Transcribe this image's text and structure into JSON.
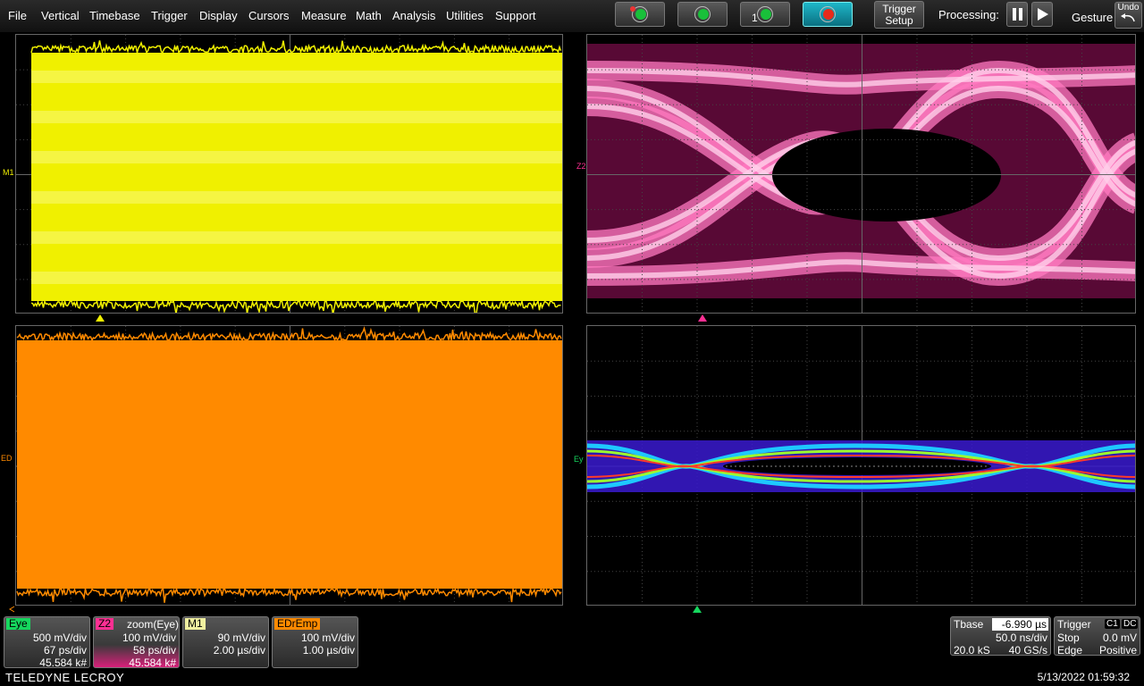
{
  "menu": [
    "File",
    "Vertical",
    "Timebase",
    "Trigger",
    "Display",
    "Cursors",
    "Measure",
    "Math",
    "Analysis",
    "Utilities",
    "Support"
  ],
  "toolbar": {
    "trigger_setup": [
      "Trigger",
      "Setup"
    ],
    "processing_label": "Processing:",
    "gesture_label": "Gesture",
    "undo_label": "Undo",
    "single_num": "1"
  },
  "grids": {
    "m1_marker": "M1",
    "z2_marker": "Z2",
    "ed_marker": "ED",
    "ey_marker": "Ey"
  },
  "colors": {
    "m1": "#f0f000",
    "z2": "#ff2f93",
    "edremp": "#ff8a00",
    "eye": "#16d75e"
  },
  "descriptors": [
    {
      "tag": "Eye",
      "tag_color": "#16d75e",
      "tag_text": "#000",
      "l1": "500 mV/div",
      "l2": "67 ps/div",
      "l3": "45.584 k#"
    },
    {
      "tag": "Z2",
      "tag_color": "#ff2f93",
      "tag_text": "#000",
      "title": "zoom(Eye)",
      "l1": "100 mV/div",
      "l2": "58 ps/div",
      "l3": "45.584 k#"
    },
    {
      "tag": "M1",
      "tag_color": "#f0f000",
      "tag_text": "#000",
      "l1": "90 mV/div",
      "l2": "2.00 µs/div",
      "l3": ""
    },
    {
      "tag": "EDrEmp",
      "tag_color": "#ff8a00",
      "tag_text": "#000",
      "l1": "100 mV/div",
      "l2": "1.00 µs/div",
      "l3": ""
    }
  ],
  "timebase": {
    "label": "Tbase",
    "delay": "-6.990 µs",
    "rate": "50.0 ns/div",
    "samples": "20.0 kS",
    "srate": "40 GS/s"
  },
  "trigger": {
    "label": "Trigger",
    "badge1": "C1",
    "badge2": "DC",
    "mode": "Stop",
    "level": "0.0 mV",
    "type": "Edge",
    "slope": "Positive"
  },
  "brand": "TELEDYNE LECROY",
  "datetime": "5/13/2022 01:59:32"
}
